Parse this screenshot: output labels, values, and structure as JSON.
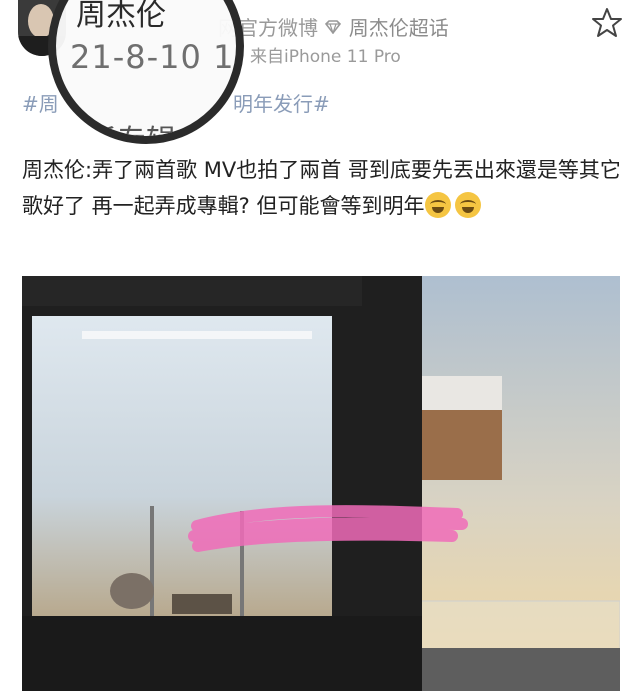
{
  "header": {
    "source_label": "网官方微博",
    "supertopic_label": "周杰伦超话",
    "device_label": "来自iPhone 11 Pro"
  },
  "magnifier": {
    "top_text": "周杰伦",
    "date_text": "21-8-10 1",
    "bottom_text": "新专辑"
  },
  "hashtag": {
    "prefix": "#周",
    "suffix": "明年发行#"
  },
  "post": {
    "body": "周杰伦:弄了兩首歌 MV也拍了兩首 哥到底要先丟出來還是等其它歌好了 再一起弄成專輯? 但可能會等到明年",
    "emojis": [
      "laugh-cry-emoji",
      "laugh-cry-emoji"
    ]
  },
  "colors": {
    "hashtag": "#8a9cb8",
    "scribble": "#f06bb8",
    "sky_top": "#aebfd0",
    "sky_bottom": "#f4d9a0"
  }
}
